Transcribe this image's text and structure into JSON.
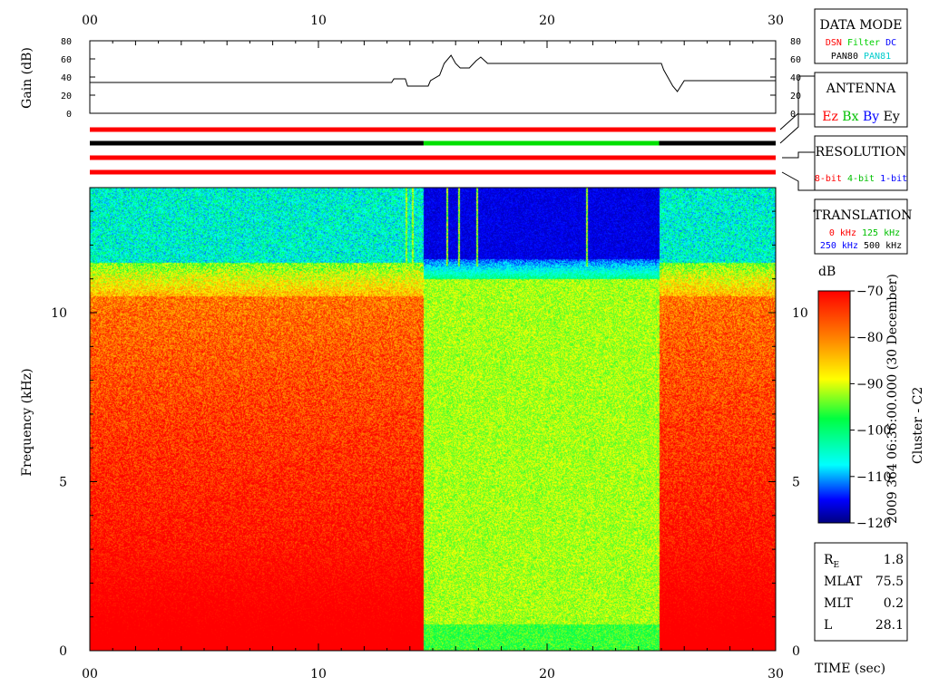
{
  "chart_data": [
    {
      "type": "line",
      "name": "gain-panel",
      "ylabel": "Gain (dB)",
      "xlim": [
        0,
        30
      ],
      "ylim": [
        0,
        80
      ],
      "x_ticks": [
        0,
        10,
        20,
        30
      ],
      "x_tick_labels": [
        "00",
        "10",
        "20",
        "30"
      ],
      "y_ticks": [
        0,
        20,
        40,
        60,
        80
      ],
      "y_tick_labels": [
        "0",
        "20",
        "40",
        "60",
        "80"
      ],
      "x": [
        0,
        13.2,
        13.3,
        13.8,
        13.9,
        14.8,
        14.9,
        15.3,
        15.5,
        15.8,
        16.0,
        16.2,
        16.6,
        16.9,
        17.1,
        17.4,
        25.0,
        25.1,
        25.5,
        25.7,
        26.0,
        30.0
      ],
      "y": [
        34,
        34,
        38,
        38,
        30,
        30,
        36,
        42,
        55,
        64,
        55,
        50,
        50,
        58,
        62,
        55,
        55,
        48,
        30,
        24,
        36,
        36
      ]
    },
    {
      "type": "table",
      "name": "mode-bars",
      "xlim": [
        0,
        30
      ],
      "rows": [
        {
          "label": "data-mode",
          "segments": [
            {
              "x0": 0,
              "x1": 30,
              "color": "#ff0000"
            }
          ]
        },
        {
          "label": "antenna",
          "segments": [
            {
              "x0": 0,
              "x1": 14.6,
              "color": "#000000"
            },
            {
              "x0": 14.6,
              "x1": 24.9,
              "color": "#00e000"
            },
            {
              "x0": 24.9,
              "x1": 30,
              "color": "#000000"
            }
          ]
        },
        {
          "label": "resolution",
          "segments": [
            {
              "x0": 0,
              "x1": 30,
              "color": "#ff0000"
            }
          ]
        },
        {
          "label": "translation",
          "segments": [
            {
              "x0": 0,
              "x1": 30,
              "color": "#ff0000"
            }
          ]
        }
      ]
    },
    {
      "type": "heatmap",
      "name": "spectrogram",
      "xlabel": "TIME (sec)",
      "ylabel": "Frequency (kHz)",
      "xlim": [
        0,
        30
      ],
      "ylim": [
        0,
        13.7
      ],
      "x_ticks": [
        0,
        10,
        20,
        30
      ],
      "x_tick_labels": [
        "00",
        "10",
        "20",
        "30"
      ],
      "y_ticks": [
        0,
        5,
        10
      ],
      "y_tick_labels": [
        "0",
        "5",
        "10"
      ],
      "colorbar": {
        "label": "dB",
        "range": [
          -120,
          -70
        ],
        "ticks": [
          -70,
          -80,
          -90,
          -100,
          -110,
          -120
        ],
        "tick_labels": [
          "-70",
          "-80",
          "-90",
          "-100",
          "-110",
          "-120"
        ]
      },
      "segments": [
        {
          "x0": 0,
          "x1": 14.6,
          "regime": "high-gain",
          "low_freq_level_db": -72,
          "high_freq_level_db": -108
        },
        {
          "x0": 14.6,
          "x1": 24.9,
          "regime": "low-gain",
          "low_freq_level_db": -95,
          "high_freq_level_db": -118
        },
        {
          "x0": 24.9,
          "x1": 30,
          "regime": "high-gain",
          "low_freq_level_db": -72,
          "high_freq_level_db": -108
        }
      ],
      "vertical_lines_x": [
        13.8,
        14.1,
        15.6,
        16.1,
        16.9,
        21.7
      ]
    }
  ],
  "side_title": "2009 364 06:36:00.000 (30 December)",
  "side_subtitle": "Cluster - C2",
  "legends": {
    "data_mode": {
      "title": "DATA MODE",
      "row1": [
        {
          "text": "DSN",
          "color": "#ff0000"
        },
        {
          "text": "Filter",
          "color": "#00d000"
        },
        {
          "text": "DC",
          "color": "#0000ff"
        }
      ],
      "row2": [
        {
          "text": "PAN80",
          "color": "#000000"
        },
        {
          "text": "PAN81",
          "color": "#00cccc"
        }
      ]
    },
    "antenna": {
      "title": "ANTENNA",
      "row1": [
        {
          "text": "Ez",
          "color": "#ff0000"
        },
        {
          "text": "Bx",
          "color": "#00c000"
        },
        {
          "text": "By",
          "color": "#0000ff"
        },
        {
          "text": "Ey",
          "color": "#000000"
        }
      ]
    },
    "resolution": {
      "title": "RESOLUTION",
      "row1": [
        {
          "text": "8-bit",
          "color": "#ff0000"
        },
        {
          "text": "4-bit",
          "color": "#00c000"
        },
        {
          "text": "1-bit",
          "color": "#0000ff"
        }
      ]
    },
    "translation": {
      "title": "TRANSLATION",
      "row1": [
        {
          "text": "0 kHz",
          "color": "#ff0000"
        },
        {
          "text": "125 kHz",
          "color": "#00c000"
        }
      ],
      "row2": [
        {
          "text": "250 kHz",
          "color": "#0000ff"
        },
        {
          "text": "500 kHz",
          "color": "#000000"
        }
      ]
    }
  },
  "orbit": [
    {
      "label": "R",
      "sub": "E",
      "value": "1.8"
    },
    {
      "label": "MLAT",
      "sub": "",
      "value": "75.5"
    },
    {
      "label": "MLT",
      "sub": "",
      "value": "0.2"
    },
    {
      "label": "L",
      "sub": "",
      "value": "28.1"
    }
  ]
}
